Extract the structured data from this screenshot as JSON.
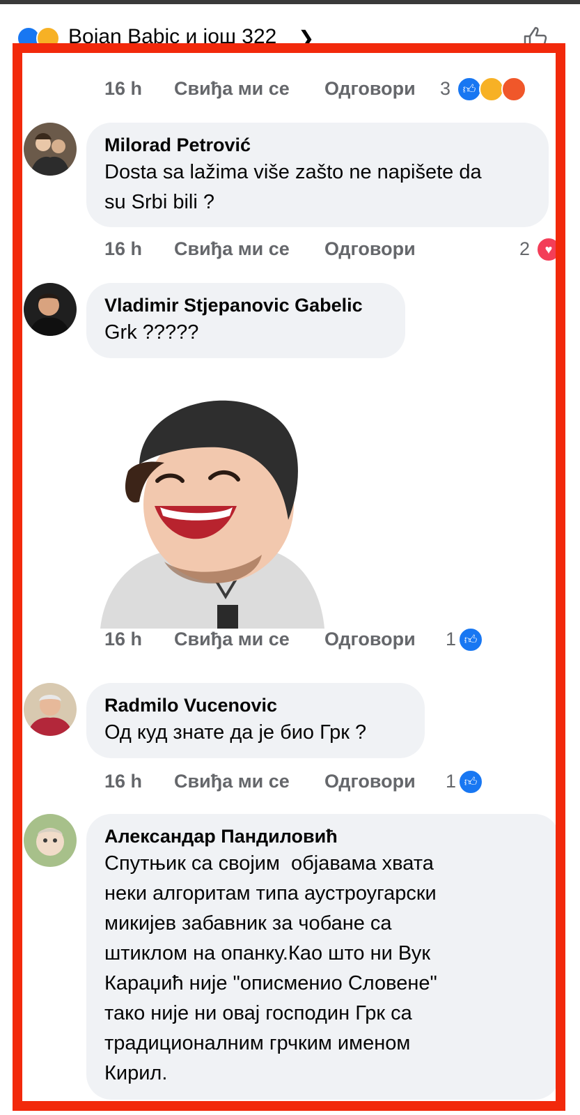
{
  "header": {
    "reactors_text": "Bojan Babic и још 322"
  },
  "comments_top": {
    "time": "16 h",
    "like_label": "Свиђа ми се",
    "reply_label": "Одговори",
    "reactions_count": "3"
  },
  "comments": [
    {
      "author": "Milorad Petrović",
      "text": "Dosta sa lažima više zašto ne napišete da\nsu Srbi bili ?",
      "time": "16 h",
      "like_label": "Свиђа ми се",
      "reply_label": "Одговори",
      "reactions_count": "2"
    },
    {
      "author": "Vladimir Stjepanovic Gabelic",
      "text": "Grk ?????",
      "time": "16 h",
      "like_label": "Свиђа ми се",
      "reply_label": "Одговори",
      "reactions_count": "1"
    },
    {
      "author": "Radmilo Vucenovic",
      "text": "Од куд знате да је био Грк ?",
      "time": "16 h",
      "like_label": "Свиђа ми се",
      "reply_label": "Одговори",
      "reactions_count": "1"
    },
    {
      "author": "Александар Пандиловић",
      "text": "Спутњик са својим  објавама хвата\nнеки алгоритам типа аустроугарски\nмикијев забавник за чобане са\nштиклом на опанку.Као што ни Вук\nКараџић није \"описменио Словене\"\nтако није ни овај господин Грк са\nтрадиционалним грчким именом\nКирил."
    }
  ],
  "colors": {
    "frame_border": "#f2290b",
    "bubble_bg": "#f0f2f5",
    "meta_text": "#65676b",
    "like_blue": "#1877f2",
    "love_red": "#f33e58"
  }
}
